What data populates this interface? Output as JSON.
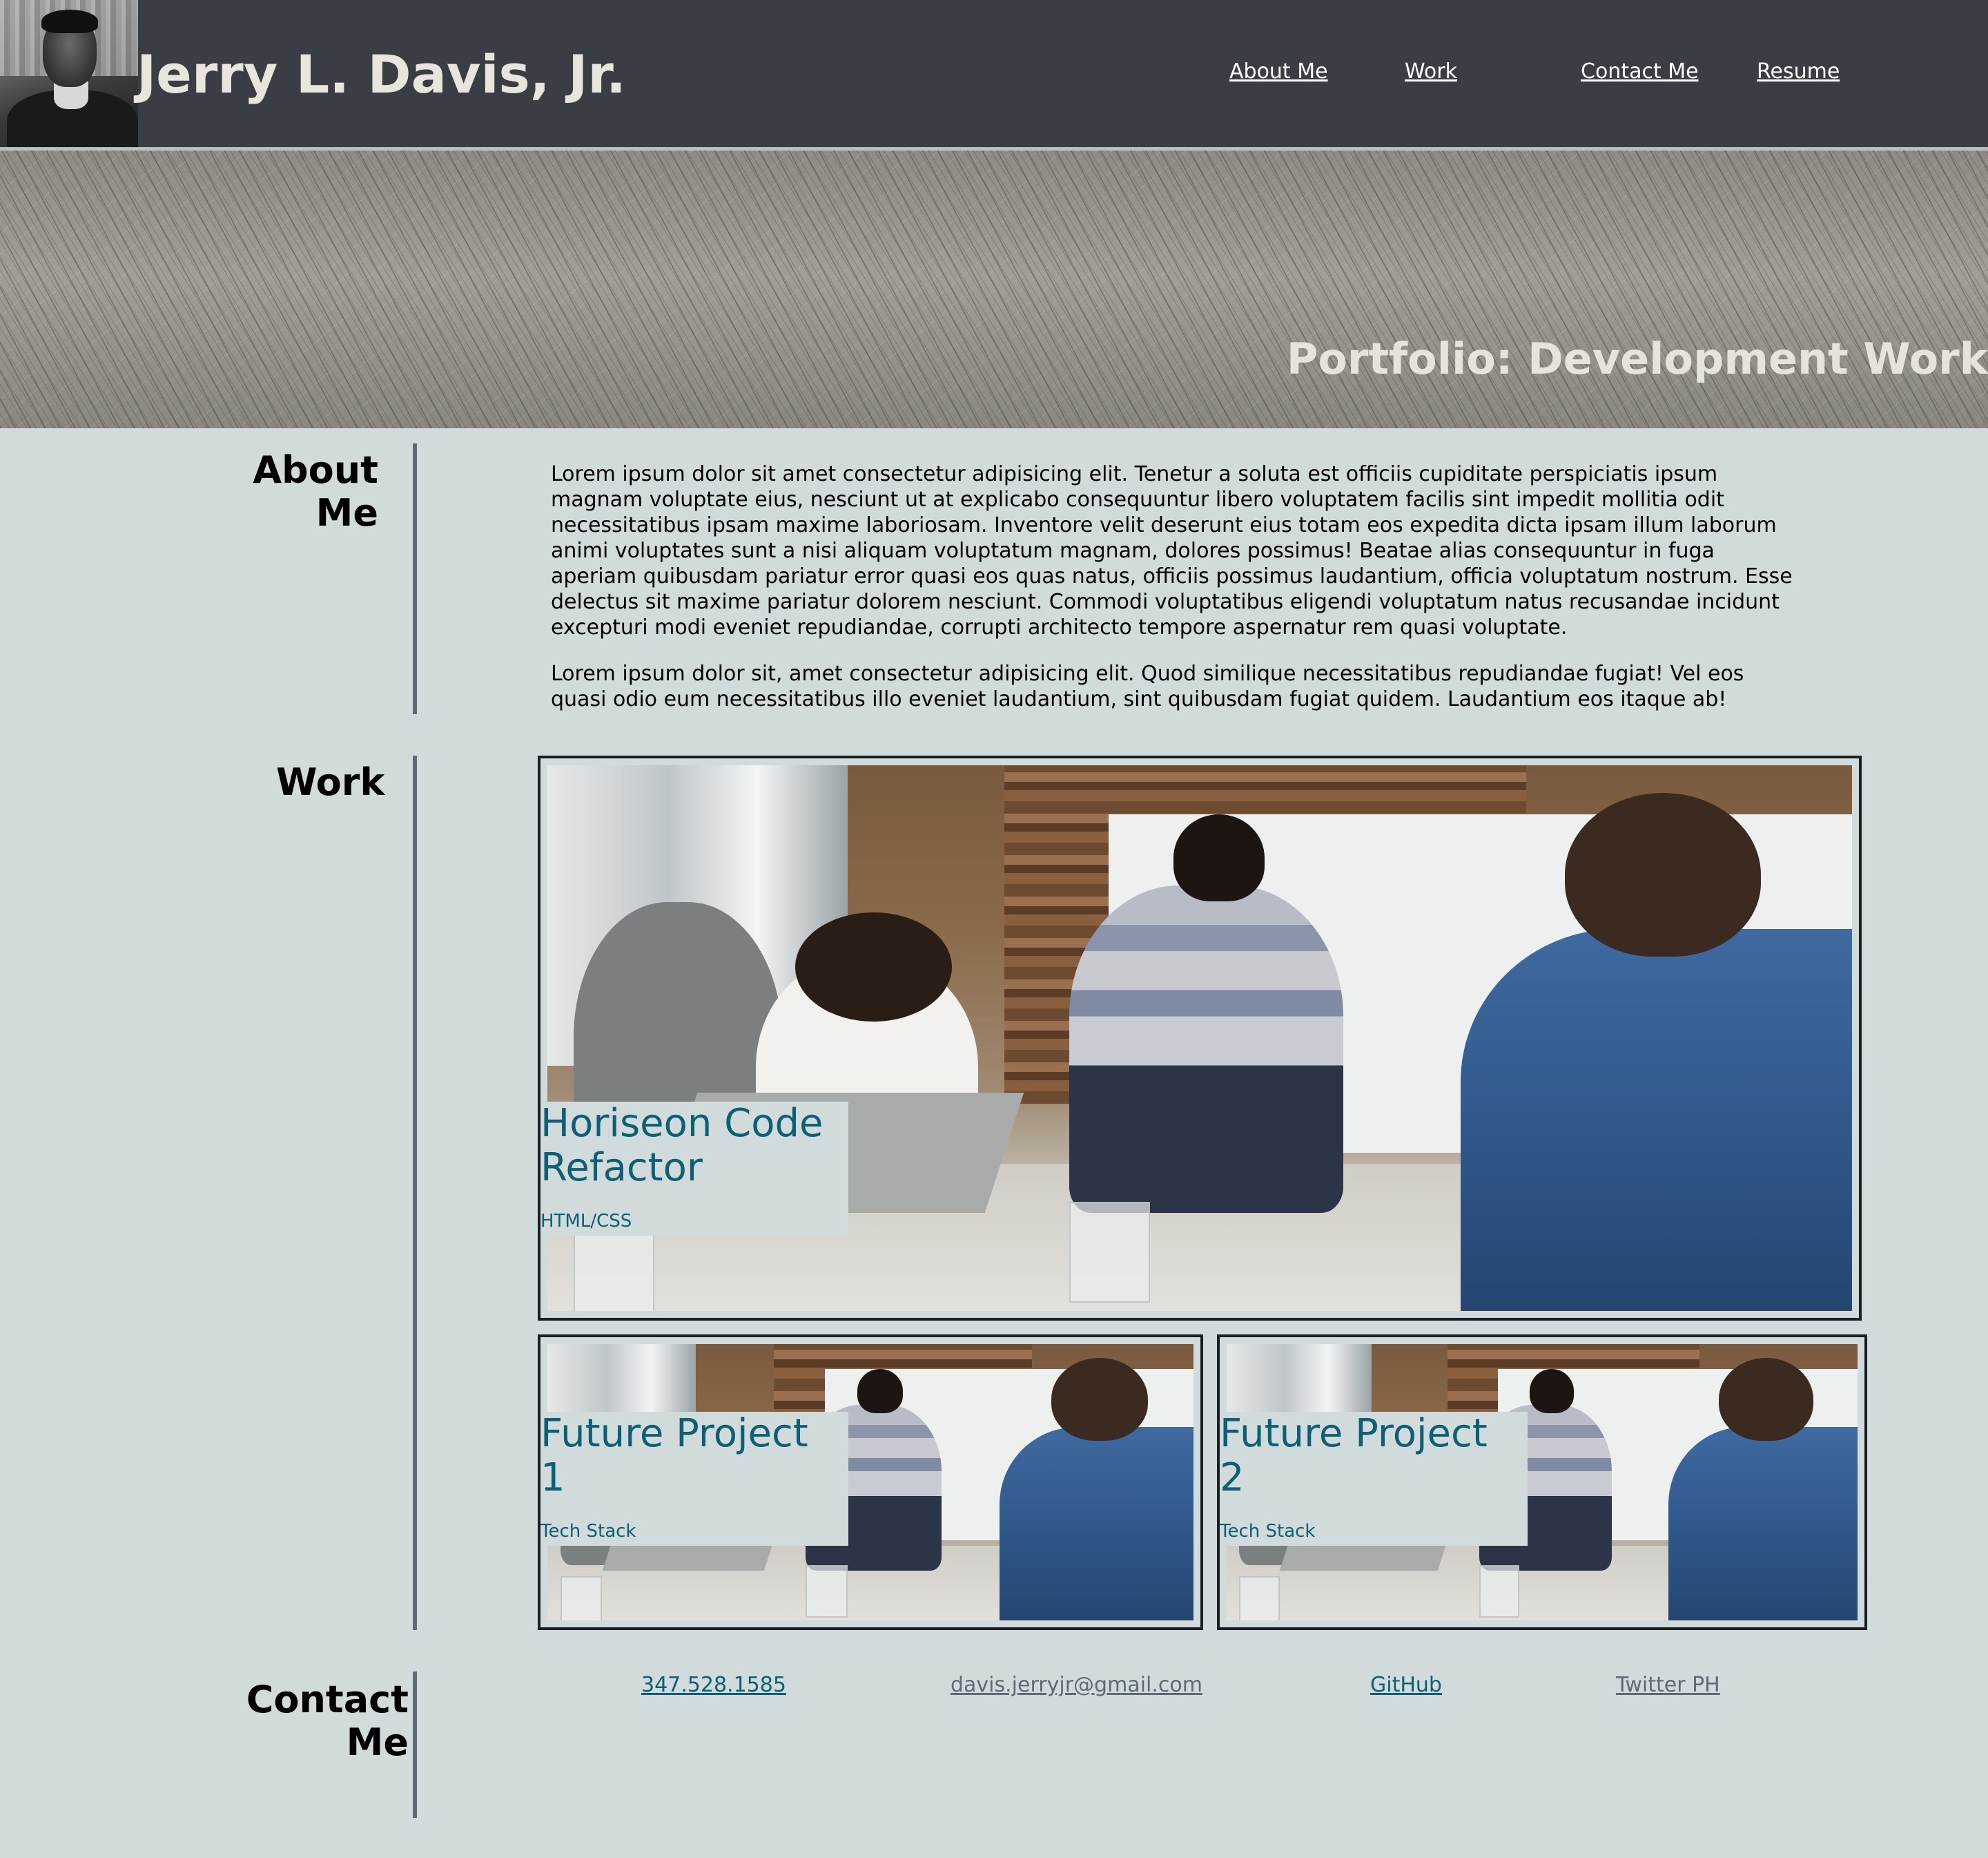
{
  "header": {
    "title": "Jerry L. Davis, Jr.",
    "nav": [
      {
        "label": "About Me"
      },
      {
        "label": "Work"
      },
      {
        "label": "Contact Me"
      },
      {
        "label": "Resume"
      }
    ]
  },
  "hero": {
    "title": "Portfolio: Development Work"
  },
  "about": {
    "heading": "About Me",
    "paragraphs": [
      "Lorem ipsum dolor sit amet consectetur adipisicing elit. Tenetur a soluta est officiis cupiditate perspiciatis ipsum magnam voluptate eius, nesciunt ut at explicabo consequuntur libero voluptatem facilis sint impedit mollitia odit necessitatibus ipsam maxime laboriosam. Inventore velit deserunt eius totam eos expedita dicta ipsam illum laborum animi voluptates sunt a nisi aliquam voluptatum magnam, dolores possimus! Beatae alias consequuntur in fuga aperiam quibusdam pariatur error quasi eos quas natus, officiis possimus laudantium, officia voluptatum nostrum. Esse delectus sit maxime pariatur dolorem nesciunt. Commodi voluptatibus eligendi voluptatum natus recusandae incidunt excepturi modi eveniet repudiandae, corrupti architecto tempore aspernatur rem quasi voluptate.",
      "Lorem ipsum dolor sit, amet consectetur adipisicing elit. Quod similique necessitatibus repudiandae fugiat! Vel eos quasi odio eum necessitatibus illo eveniet laudantium, sint quibusdam fugiat quidem. Laudantium eos itaque ab!"
    ]
  },
  "work": {
    "heading": "Work",
    "projects": [
      {
        "title_line1": "Horiseon Code",
        "title_line2": "Refactor",
        "stack": "HTML/CSS"
      },
      {
        "title_line1": "Future Project",
        "title_line2": "1",
        "stack": "Tech Stack"
      },
      {
        "title_line1": "Future Project",
        "title_line2": "2",
        "stack": "Tech Stack"
      }
    ]
  },
  "contact": {
    "heading_line1": "Contact",
    "heading_line2": "Me",
    "links": [
      {
        "label": "347.528.1585",
        "color": "#0c5f74"
      },
      {
        "label": "davis.jerryjr@gmail.com",
        "color": "#5c6b75"
      },
      {
        "label": "GitHub",
        "color": "#0c5f74"
      },
      {
        "label": "Twitter PH",
        "color": "#5c6b75"
      }
    ]
  },
  "colors": {
    "header_bg": "#3b3d44",
    "page_bg": "#d1dbdb",
    "accent": "#0c5f74",
    "divider": "#5c6b75"
  }
}
